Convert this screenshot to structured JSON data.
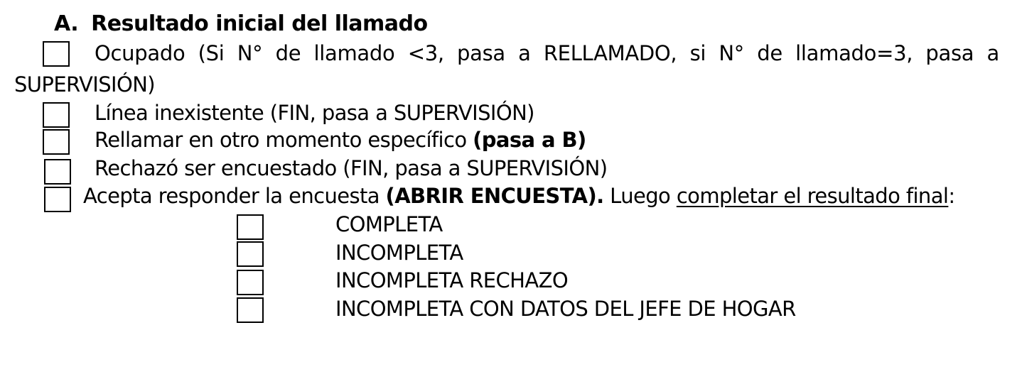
{
  "section": {
    "letter": "A.",
    "title": "Resultado inicial del llamado"
  },
  "options": [
    {
      "label_line1": "Ocupado (Si N° de llamado <3, pasa a RELLAMADO, si N° de llamado=3, pasa a",
      "label_line2": "SUPERVISIÓN)"
    },
    {
      "label": "Línea inexistente (FIN, pasa a SUPERVISIÓN)"
    },
    {
      "label": "Rellamar en otro momento específico ",
      "bold_suffix": "(pasa a B)"
    },
    {
      "label": "Rechazó ser encuestado (FIN, pasa a SUPERVISIÓN)"
    },
    {
      "label": "Acepta responder la encuesta ",
      "bold_part": "(ABRIR ENCUESTA).",
      "middle": " Luego ",
      "underlined": "completar el resultado final",
      "end": ":"
    }
  ],
  "final_results": [
    "COMPLETA",
    "INCOMPLETA",
    "INCOMPLETA RECHAZO",
    "INCOMPLETA CON DATOS DEL JEFE DE HOGAR"
  ]
}
